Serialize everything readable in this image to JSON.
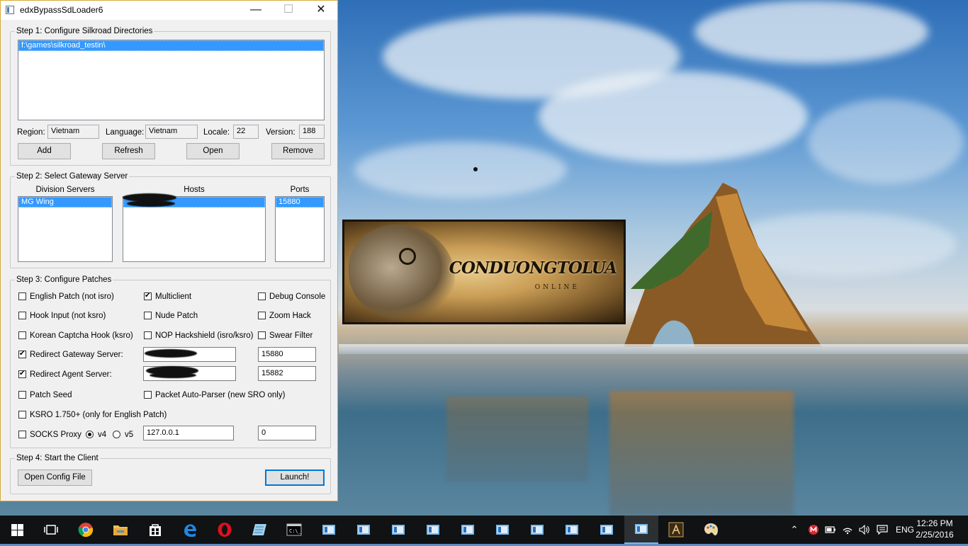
{
  "window": {
    "title": "edxBypassSdLoader6",
    "min_glyph": "—",
    "max_glyph": "☐",
    "close_glyph": "✕"
  },
  "step1": {
    "legend": "Step 1: Configure Silkroad Directories",
    "directories": [
      "f:\\games\\silkroad_testin\\"
    ],
    "region_label": "Region:",
    "region_value": "Vietnam",
    "language_label": "Language:",
    "language_value": "Vietnam",
    "locale_label": "Locale:",
    "locale_value": "22",
    "version_label": "Version:",
    "version_value": "188",
    "add_label": "Add",
    "refresh_label": "Refresh",
    "open_label": "Open",
    "remove_label": "Remove"
  },
  "step2": {
    "legend": "Step 2: Select Gateway Server",
    "division_header": "Division Servers",
    "hosts_header": "Hosts",
    "ports_header": "Ports",
    "divisions": [
      "MG Wing"
    ],
    "ports": [
      "15880"
    ]
  },
  "step3": {
    "legend": "Step 3: Configure Patches",
    "english_patch": {
      "label": "English Patch (not isro)",
      "checked": false
    },
    "multiclient": {
      "label": "Multiclient",
      "checked": true
    },
    "debug_console": {
      "label": "Debug Console",
      "checked": false
    },
    "hook_input": {
      "label": "Hook Input (not ksro)",
      "checked": false
    },
    "nude_patch": {
      "label": "Nude Patch",
      "checked": false
    },
    "zoom_hack": {
      "label": "Zoom Hack",
      "checked": false
    },
    "korean_captcha": {
      "label": "Korean Captcha Hook (ksro)",
      "checked": false
    },
    "nop_hackshield": {
      "label": "NOP Hackshield (isro/ksro)",
      "checked": false
    },
    "swear_filter": {
      "label": "Swear Filter",
      "checked": false
    },
    "redirect_gateway": {
      "label": "Redirect Gateway Server:",
      "checked": true,
      "port": "15880"
    },
    "redirect_agent": {
      "label": "Redirect Agent Server:",
      "checked": true,
      "port": "15882"
    },
    "patch_seed": {
      "label": "Patch Seed",
      "checked": false
    },
    "packet_parser": {
      "label": "Packet Auto-Parser (new SRO only)",
      "checked": false
    },
    "ksro": {
      "label": "KSRO 1.750+ (only for English Patch)",
      "checked": false
    },
    "socks_proxy": {
      "label": "SOCKS Proxy",
      "checked": false,
      "v4_label": "v4",
      "v5_label": "v5",
      "selected": "v4",
      "address": "127.0.0.1",
      "port": "0"
    }
  },
  "step4": {
    "legend": "Step 4: Start the Client",
    "open_config_label": "Open Config File",
    "launch_label": "Launch!"
  },
  "splash": {
    "logo_text": "CONDUONGTOLUA",
    "logo_sub": "ONLINE"
  },
  "taskbar": {
    "tray_up": "⌃",
    "language": "ENG",
    "time": "12:26 PM",
    "date": "2/25/2016"
  },
  "colors": {
    "selection": "#3399ff",
    "window_border": "#d7a93e",
    "taskbar": "#101214",
    "accent": "#76b9ed"
  }
}
